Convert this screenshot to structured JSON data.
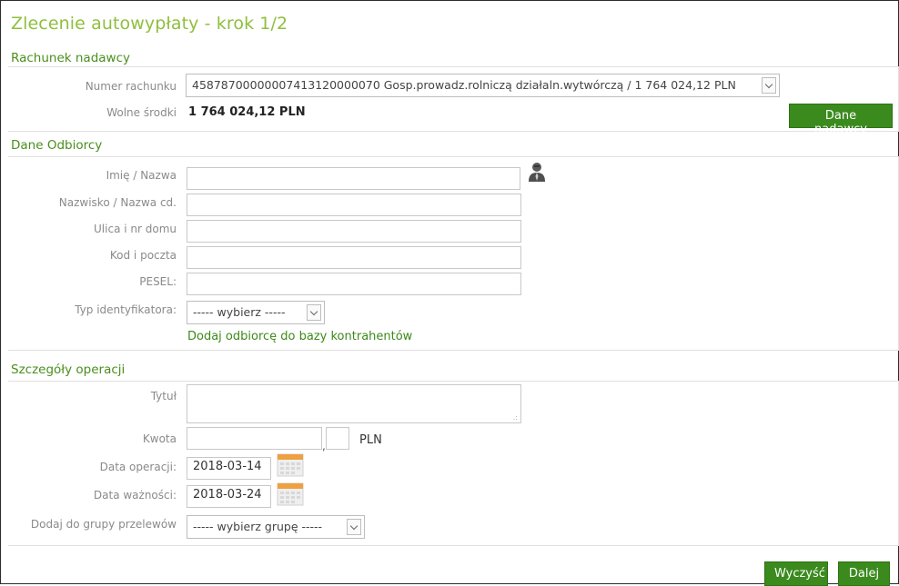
{
  "title": "Zlecenie autowypłaty - krok 1/2",
  "sections": {
    "sender": "Rachunek nadawcy",
    "recipient": "Dane Odbiorcy",
    "details": "Szczegóły operacji"
  },
  "sender": {
    "account_label": "Numer rachunku",
    "account_value": "45878700000007413120000070 Gosp.prowadz.rolniczą działaln.wytwórczą / 1 764 024,12 PLN",
    "funds_label": "Wolne środki",
    "funds_value": "1 764 024,12 PLN",
    "sender_data_button": "Dane nadawcy"
  },
  "recipient": {
    "name_label": "Imię / Nazwa",
    "surname_label": "Nazwisko / Nazwa cd.",
    "street_label": "Ulica i nr domu",
    "postal_label": "Kod i poczta",
    "pesel_label": "PESEL:",
    "id_type_label": "Typ identyfikatora:",
    "id_type_value": "----- wybierz -----",
    "add_contractor_link": "Dodaj odbiorcę do bazy kontrahentów"
  },
  "details": {
    "title_label": "Tytuł",
    "amount_label": "Kwota",
    "currency": "PLN",
    "date_label": "Data operacji:",
    "date_value": "2018-03-14",
    "expiry_label": "Data ważności:",
    "expiry_value": "2018-03-24",
    "group_label": "Dodaj do grupy przelewów",
    "group_value": "----- wybierz grupę -----"
  },
  "actions": {
    "clear": "Wyczyść",
    "next": "Dalej"
  },
  "colors": {
    "accent_green": "#3b8a1e",
    "title_green": "#8fbf3e",
    "section_green": "#4a8f1c"
  }
}
